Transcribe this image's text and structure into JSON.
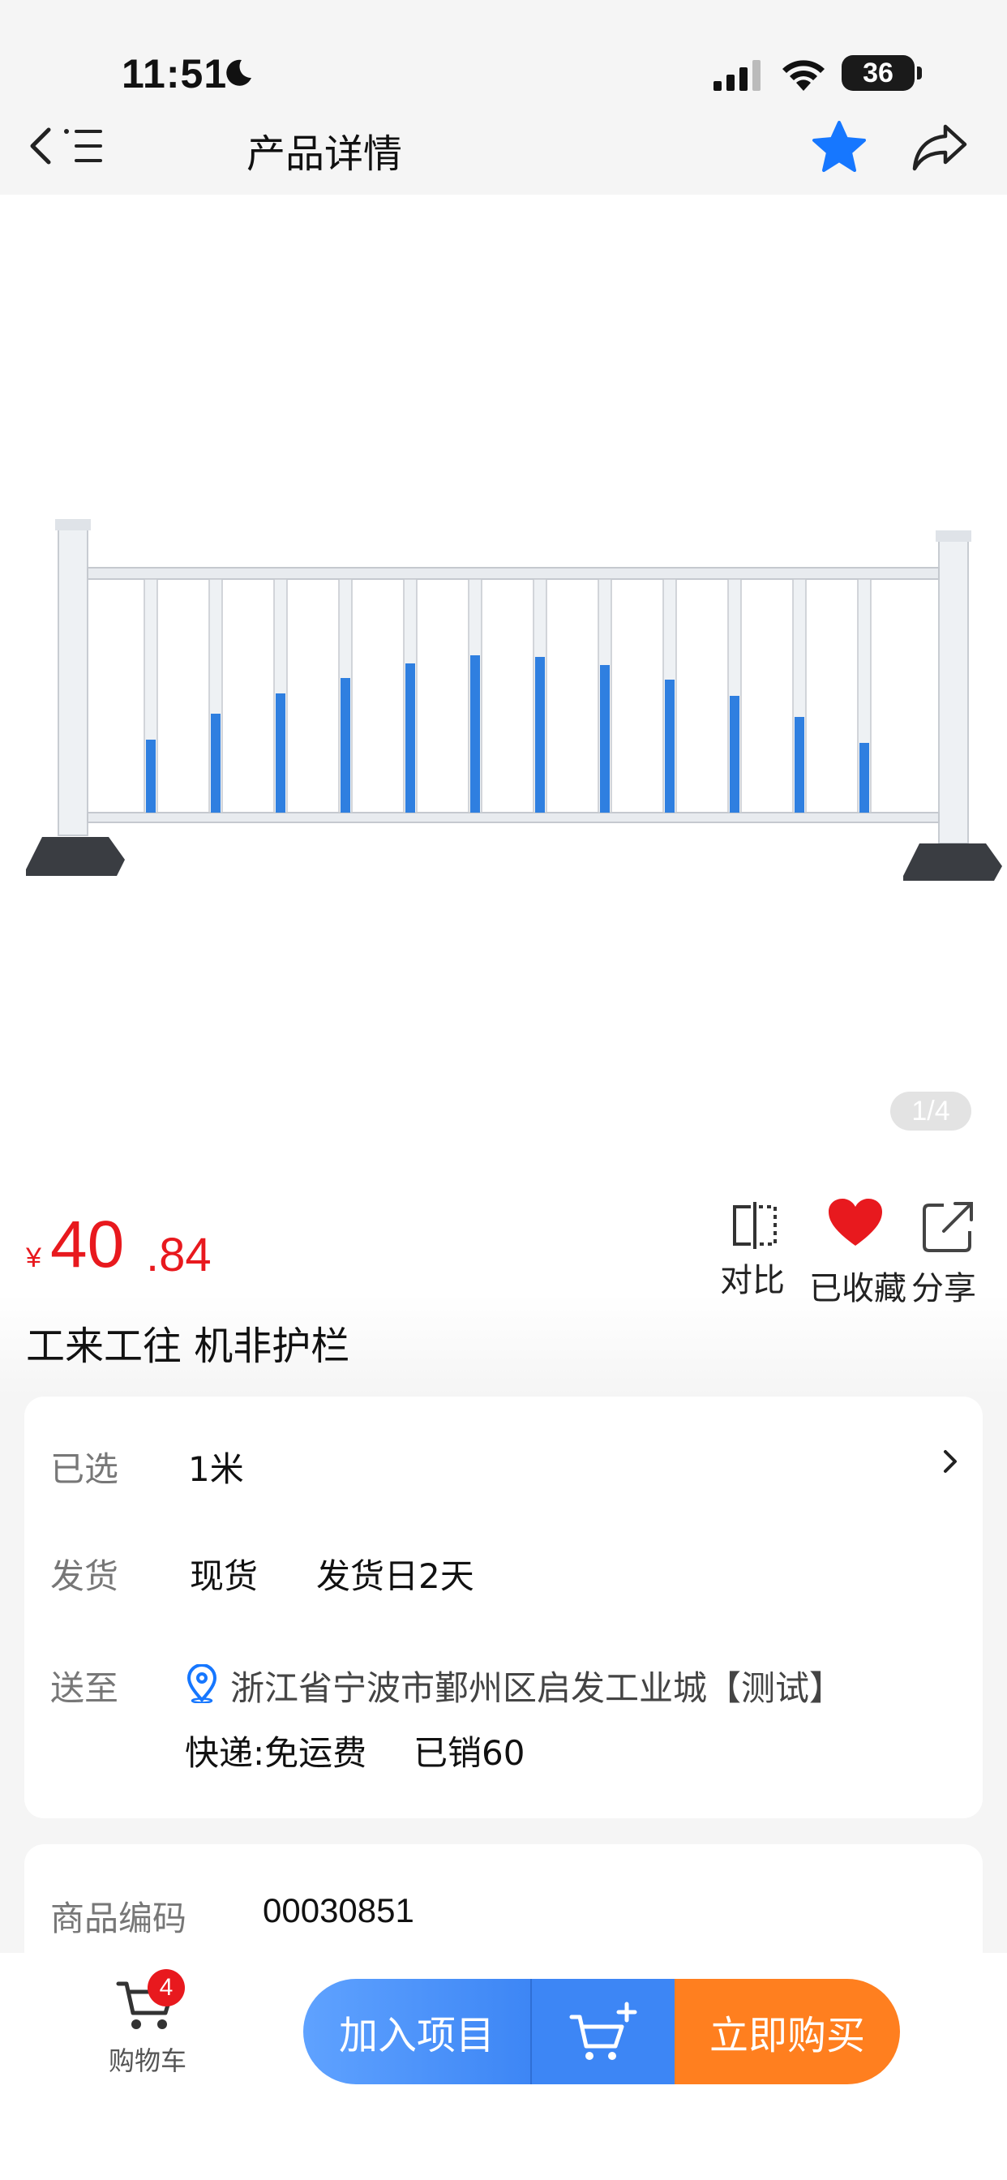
{
  "status_bar": {
    "time": "11:51",
    "battery": "36"
  },
  "nav": {
    "title": "产品详情"
  },
  "gallery": {
    "pager": "1/4"
  },
  "price": {
    "currency": "¥",
    "integer": "40",
    "decimal": ".84"
  },
  "actions": {
    "compare": "对比",
    "favorite": "已收藏",
    "share": "分享"
  },
  "product": {
    "name": "工来工往 机非护栏"
  },
  "spec": {
    "selected_label": "已选",
    "selected_value": "1米",
    "ship_label": "发货",
    "ship_stock": "现货",
    "ship_days": "发货日2天",
    "deliver_label": "送至",
    "address": "浙江省宁波市鄞州区启发工业城【测试】",
    "express": "快递:免运费",
    "sold": "已销60"
  },
  "code": {
    "label": "商品编码",
    "value": "00030851"
  },
  "bottom_bar": {
    "cart_label": "购物车",
    "cart_count": "4",
    "add_project": "加入项目",
    "buy_now": "立即购买"
  },
  "colors": {
    "price_red": "#e8191e",
    "favorite_red": "#e8191e",
    "accent_blue": "#1677ff",
    "buy_orange": "#ff7f1f"
  }
}
